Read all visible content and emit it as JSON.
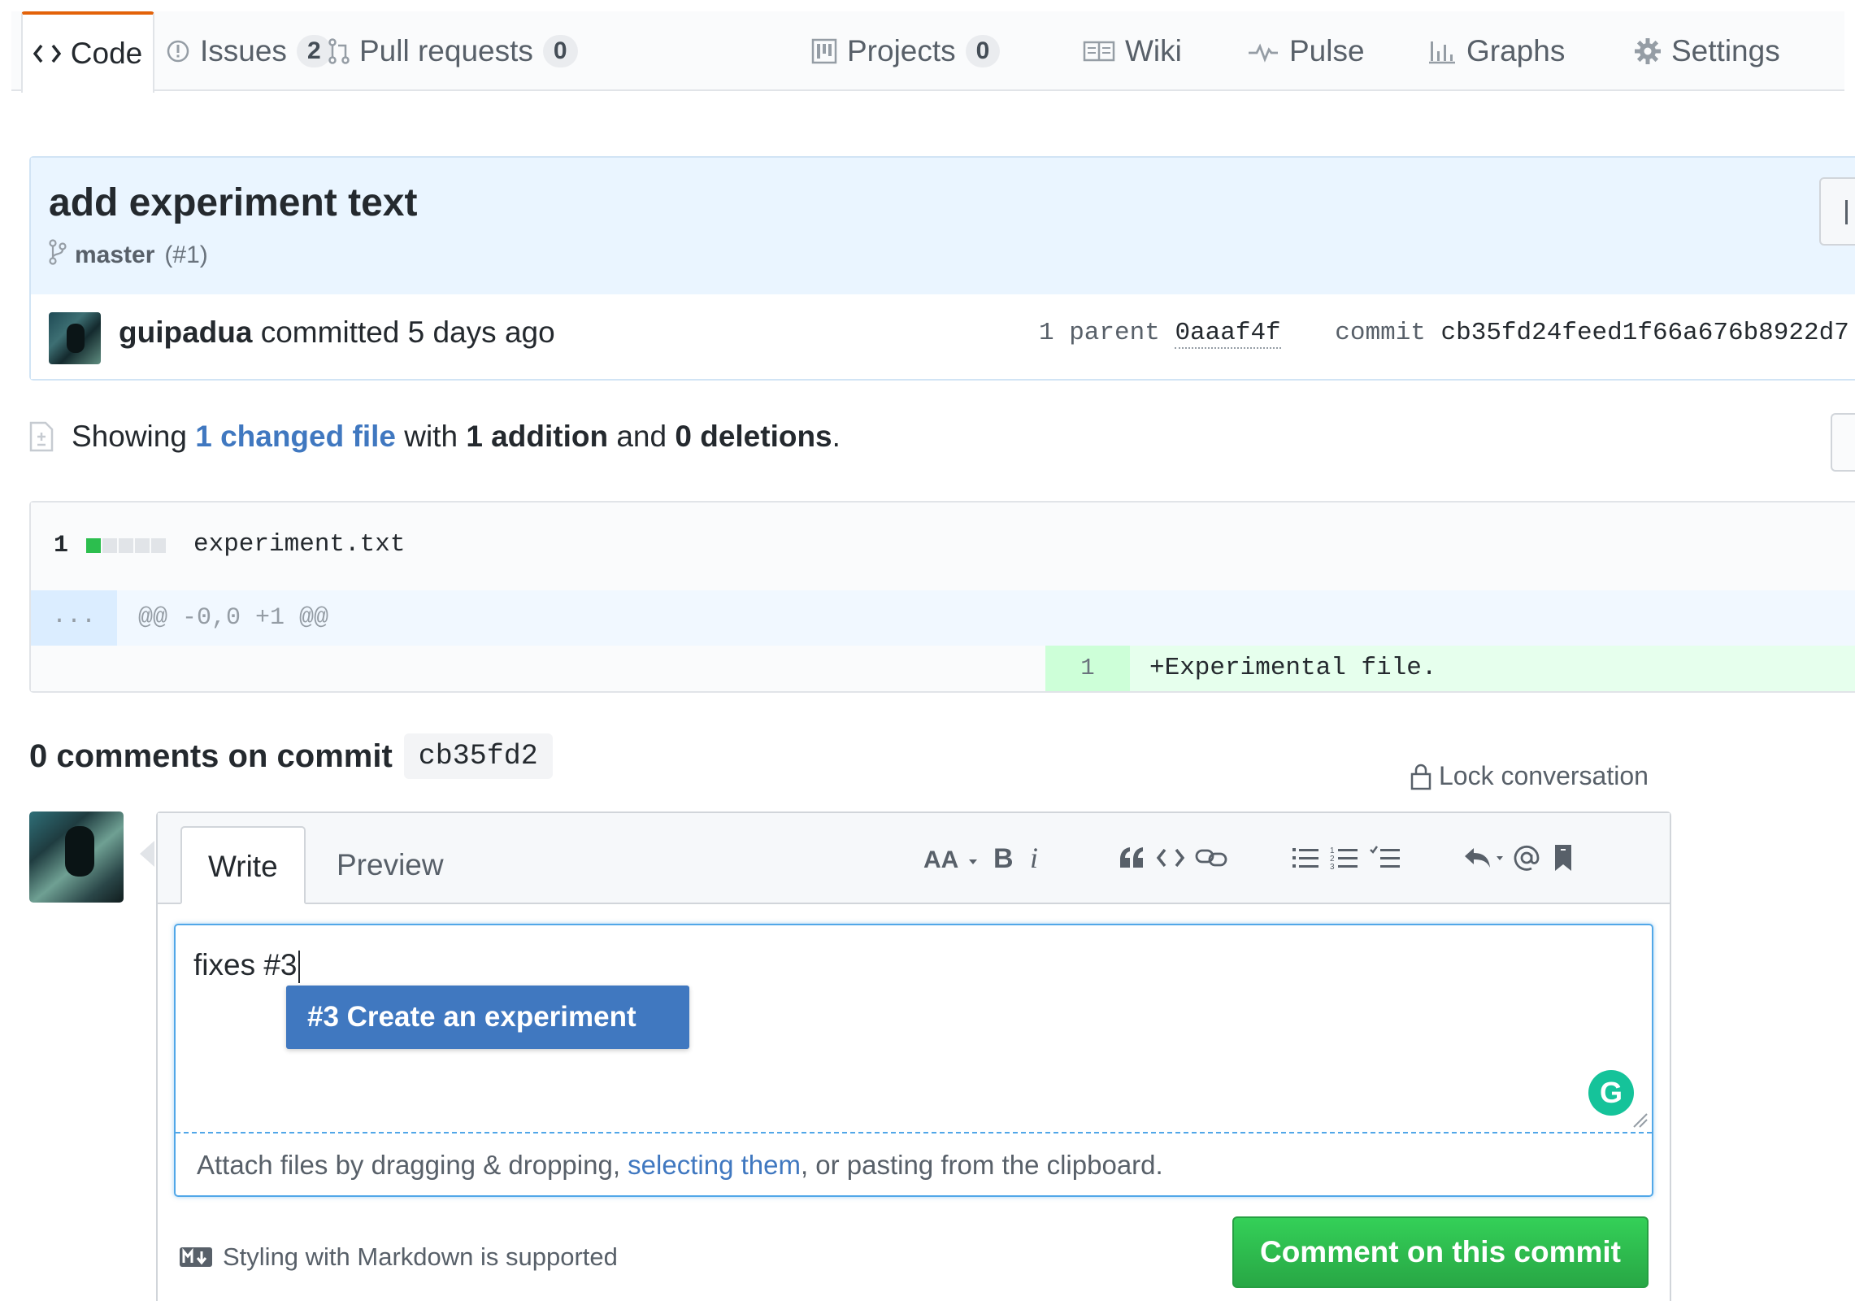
{
  "repo_nav": {
    "tabs": [
      {
        "label": "Code",
        "icon": "code-icon",
        "selected": true
      },
      {
        "label": "Issues",
        "count": "2",
        "icon": "issue-opened-icon"
      },
      {
        "label": "Pull requests",
        "count": "0",
        "icon": "git-pull-request-icon"
      },
      {
        "label": "Projects",
        "count": "0",
        "icon": "project-icon"
      },
      {
        "label": "Wiki",
        "icon": "book-icon"
      },
      {
        "label": "Pulse",
        "icon": "pulse-icon"
      },
      {
        "label": "Graphs",
        "icon": "graph-icon"
      },
      {
        "label": "Settings",
        "icon": "gear-icon"
      }
    ]
  },
  "commit": {
    "title": "add experiment text",
    "branch": "master",
    "pr_ref": "(#1)",
    "author": "guipadua",
    "committed_text": "committed 5 days ago",
    "parent_label": "1 parent",
    "parent_sha": "0aaaf4f",
    "commit_label": "commit",
    "commit_sha": "cb35fd24feed1f66a676b8922d7"
  },
  "summary": {
    "prefix": "Showing",
    "changed_files": "1 changed file",
    "with": "with",
    "additions": "1 addition",
    "and": "and",
    "deletions": "0 deletions",
    "end": "."
  },
  "file": {
    "change_count": "1",
    "name": "experiment.txt",
    "hunk_expander": "...",
    "hunk_header": "@@ -0,0 +1 @@",
    "line_number": "1",
    "line_content": "+Experimental file."
  },
  "comments": {
    "heading": "0 comments on commit",
    "short_sha": "cb35fd2",
    "lock_label": "Lock conversation",
    "tabs": {
      "write": "Write",
      "preview": "Preview"
    },
    "toolbar_icons": [
      "text-size-icon",
      "bold-icon",
      "italic-icon",
      "quote-icon",
      "code-icon",
      "link-icon",
      "unordered-list-icon",
      "ordered-list-icon",
      "task-list-icon",
      "reply-icon",
      "mention-icon",
      "bookmark-icon"
    ],
    "text_value": "fixes #3",
    "suggestion": "#3 Create an experiment",
    "grammarly_letter": "G",
    "attach_prefix": "Attach files by dragging & dropping, ",
    "attach_link": "selecting them",
    "attach_suffix": ", or pasting from the clipboard.",
    "markdown_note": "Styling with Markdown is supported",
    "submit_label": "Comment on this commit"
  },
  "colors": {
    "accent_link": "#4078c0",
    "success": "#28a745",
    "selected_tab_border": "#e36209",
    "header_bg": "#eaf5ff",
    "addition_bg": "#e6ffed"
  }
}
